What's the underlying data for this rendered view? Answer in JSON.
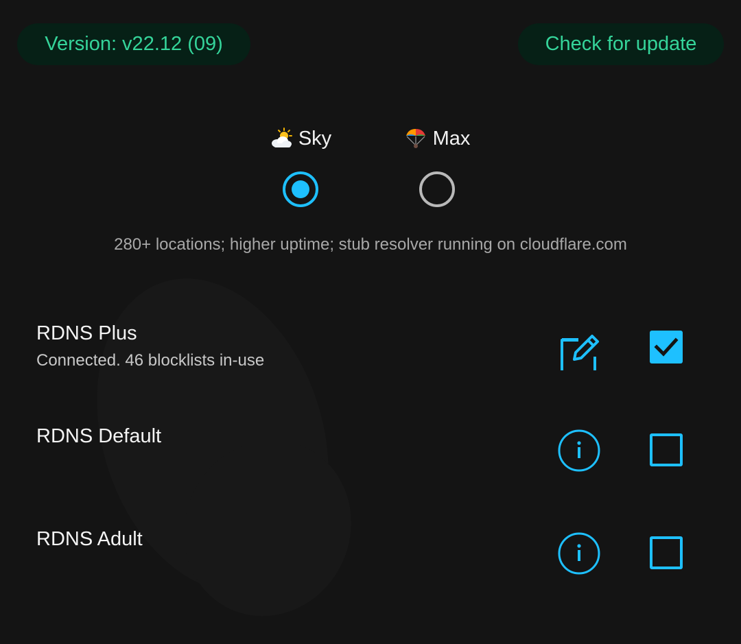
{
  "header": {
    "version_label": "Version: v22.12 (09)",
    "update_label": "Check for update"
  },
  "modes": {
    "selected": "Sky",
    "options": [
      {
        "emoji": "⛅",
        "label": "Sky",
        "selected": true
      },
      {
        "emoji": "🪂",
        "label": "Max",
        "selected": false
      }
    ],
    "description": "280+ locations; higher uptime; stub resolver running on cloudflare.com"
  },
  "resolvers": [
    {
      "title": "RDNS Plus",
      "subtitle": "Connected. 46 blocklists in-use",
      "action_icon": "edit-icon",
      "checked": true
    },
    {
      "title": "RDNS Default",
      "subtitle": "",
      "action_icon": "info-icon",
      "checked": false
    },
    {
      "title": "RDNS Adult",
      "subtitle": "",
      "action_icon": "info-icon",
      "checked": false
    }
  ],
  "colors": {
    "background": "#141414",
    "accent": "#1ec0ff",
    "version_text": "#35d49a",
    "pill_background": "#062016",
    "unselected_radio": "#b9b9b9"
  }
}
